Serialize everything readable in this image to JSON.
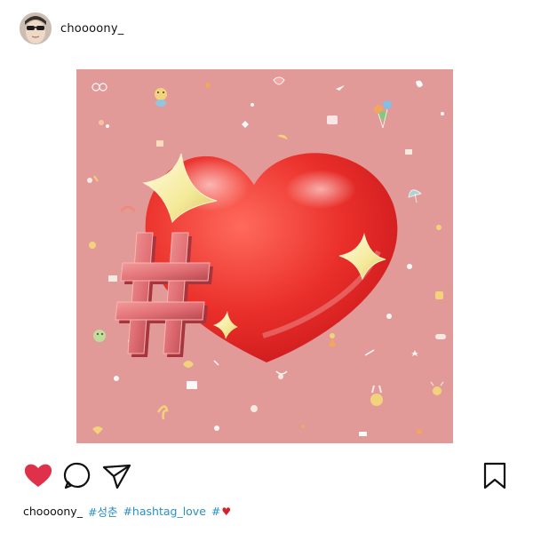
{
  "post": {
    "username": "choooony_",
    "image_alt_icons": "heart-with-hashtag-illustration"
  },
  "actions": {
    "like_icon": "heart-filled-icon",
    "comment_icon": "comment-bubble-icon",
    "share_icon": "send-paper-plane-icon",
    "save_icon": "bookmark-icon",
    "like_color": "#e0314b"
  },
  "caption": {
    "username": "choooony_",
    "hashtags": [
      "#성춘",
      "#hashtag_love",
      "#"
    ],
    "trailing_emoji": "♥"
  },
  "colors": {
    "background": "#ffffff",
    "image_bg": "#e29a98",
    "heart": "#e8342f",
    "hashtag_blue": "#2a8fc9",
    "sparkle": "#f2e9a0"
  }
}
